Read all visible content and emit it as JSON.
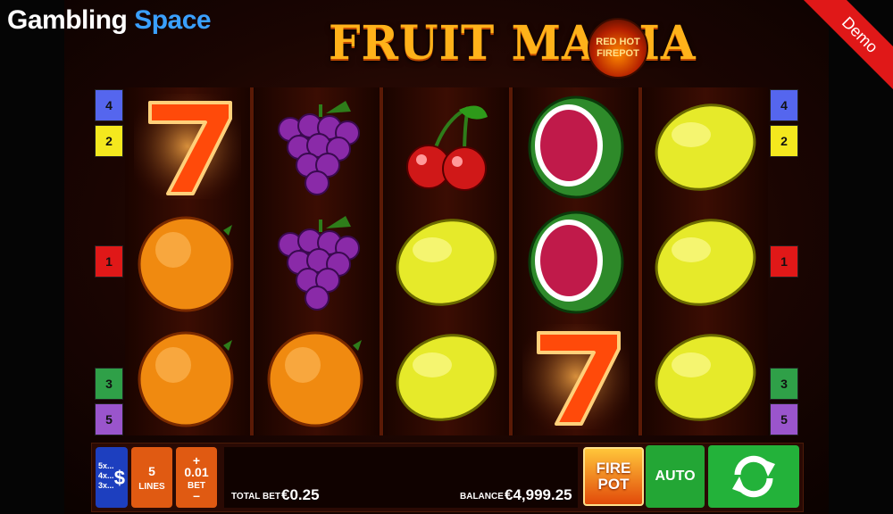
{
  "brand": {
    "part1": "Gambling",
    "part2": "Space"
  },
  "demo_label": "Demo",
  "game": {
    "title": "FRUIT MANIA",
    "badge_line1": "RED HOT",
    "badge_line2": "FIREPOT"
  },
  "paylines": {
    "left": [
      "4",
      "2",
      "1",
      "3",
      "5"
    ],
    "right": [
      "4",
      "2",
      "1",
      "3",
      "5"
    ],
    "colors": {
      "4": "#5566ee",
      "2": "#f4e81e",
      "1": "#e01818",
      "3": "#2fa048",
      "5": "#9a55cc"
    }
  },
  "reels": [
    [
      "seven",
      "orange",
      "orange"
    ],
    [
      "grapes",
      "grapes",
      "orange"
    ],
    [
      "cherries",
      "lemon",
      "lemon"
    ],
    [
      "watermelon",
      "watermelon",
      "seven"
    ],
    [
      "lemon",
      "lemon",
      "lemon"
    ]
  ],
  "controls": {
    "coin_rows": [
      "5x...",
      "4x...",
      "3x..."
    ],
    "currency_icon": "dollar-icon",
    "lines_value": "5",
    "lines_label": "LINES",
    "bet_plus": "+",
    "bet_value": "0.01",
    "bet_label": "BET",
    "bet_minus": "–",
    "total_bet_label": "TOTAL BET",
    "total_bet_value": "€0.25",
    "balance_label": "BALANCE",
    "balance_value": "€4,999.25",
    "firepot_line1": "FIRE",
    "firepot_line2": "POT",
    "auto_label": "AUTO",
    "spin_icon": "spin-arrows-icon"
  }
}
